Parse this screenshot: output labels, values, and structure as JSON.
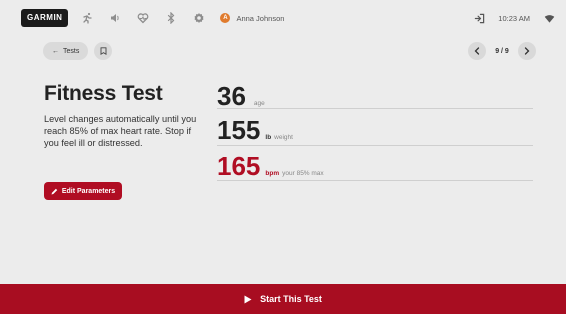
{
  "topbar": {
    "logo": "GARMIN",
    "icons": [
      "run-icon",
      "speaker-icon",
      "heart-icon",
      "bluetooth-icon",
      "gear-icon"
    ],
    "avatar_initial": "A",
    "user_name": "Anna Johnson",
    "time": "10:23 AM"
  },
  "nav": {
    "back_label": "Tests",
    "page_indicator": "9 / 9"
  },
  "test": {
    "title": "Fitness Test",
    "description": "Level changes automatically until you reach 85% of max heart rate. Stop if you feel ill or distressed.",
    "edit_label": "Edit Parameters"
  },
  "stats": [
    {
      "value": "36",
      "unit": "",
      "label": "age"
    },
    {
      "value": "155",
      "unit": "lb",
      "label": "weight"
    },
    {
      "value": "165",
      "unit": "bpm",
      "label": "your 85% max"
    }
  ],
  "start": {
    "label": "Start This Test"
  },
  "colors": {
    "accent": "#a80d21",
    "background": "#ececec"
  }
}
